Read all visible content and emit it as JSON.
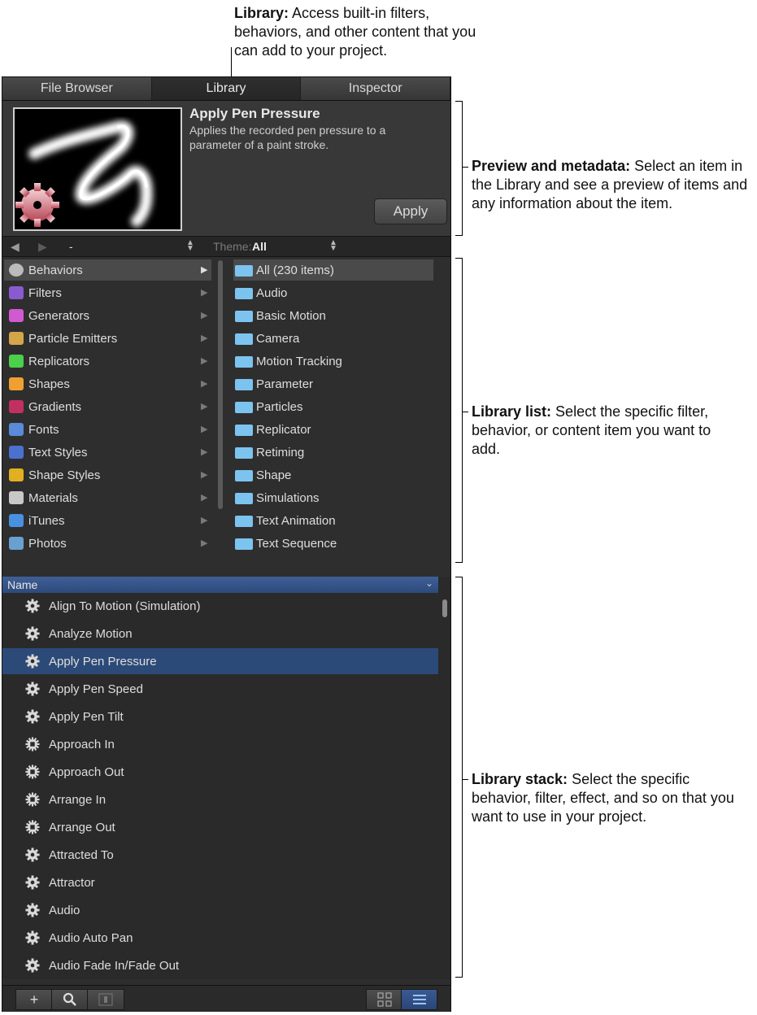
{
  "callouts": {
    "library": {
      "bold": "Library:",
      "text": "Access built-in filters, behaviors, and other content that you can add to your project."
    },
    "preview": {
      "bold": "Preview and metadata:",
      "text": "Select an item in the Library and see a preview of items and any information about the item."
    },
    "list": {
      "bold": "Library list:",
      "text": "Select the specific filter, behavior, or content item you want to add."
    },
    "stack": {
      "bold": "Library stack:",
      "text": "Select the specific behavior, filter, effect, and so on that you want to use in your project."
    }
  },
  "tabs": [
    {
      "label": "File Browser",
      "active": false
    },
    {
      "label": "Library",
      "active": true
    },
    {
      "label": "Inspector",
      "active": false
    }
  ],
  "preview": {
    "title": "Apply Pen Pressure",
    "description": "Applies the recorded pen pressure to a parameter of a paint stroke.",
    "apply_label": "Apply"
  },
  "nav": {
    "path_value": "-",
    "theme_label": "Theme:",
    "theme_value": "All"
  },
  "categories": [
    {
      "label": "Behaviors",
      "icon": "gear-icon",
      "color": "#bbbbbb",
      "selected": true
    },
    {
      "label": "Filters",
      "icon": "filters-icon",
      "color": "#8a5ad0",
      "selected": false
    },
    {
      "label": "Generators",
      "icon": "generators-icon",
      "color": "#d05ad0",
      "selected": false
    },
    {
      "label": "Particle Emitters",
      "icon": "particle-icon",
      "color": "#d4a64a",
      "selected": false
    },
    {
      "label": "Replicators",
      "icon": "replicator-icon",
      "color": "#4ad04a",
      "selected": false
    },
    {
      "label": "Shapes",
      "icon": "shapes-icon",
      "color": "#f0a030",
      "selected": false
    },
    {
      "label": "Gradients",
      "icon": "gradient-icon",
      "color": "#c03060",
      "selected": false
    },
    {
      "label": "Fonts",
      "icon": "font-icon",
      "color": "#5a8ad8",
      "selected": false
    },
    {
      "label": "Text Styles",
      "icon": "text-style-icon",
      "color": "#4a70d0",
      "selected": false
    },
    {
      "label": "Shape Styles",
      "icon": "shape-style-icon",
      "color": "#e0b020",
      "selected": false
    },
    {
      "label": "Materials",
      "icon": "materials-icon",
      "color": "#c8c8c8",
      "selected": false
    },
    {
      "label": "iTunes",
      "icon": "itunes-icon",
      "color": "#4a90e0",
      "selected": false
    },
    {
      "label": "Photos",
      "icon": "photos-icon",
      "color": "#6aa0d0",
      "selected": false
    }
  ],
  "folders": [
    {
      "label": "All (230 items)",
      "selected": true
    },
    {
      "label": "Audio",
      "selected": false
    },
    {
      "label": "Basic Motion",
      "selected": false
    },
    {
      "label": "Camera",
      "selected": false
    },
    {
      "label": "Motion Tracking",
      "selected": false
    },
    {
      "label": "Parameter",
      "selected": false
    },
    {
      "label": "Particles",
      "selected": false
    },
    {
      "label": "Replicator",
      "selected": false
    },
    {
      "label": "Retiming",
      "selected": false
    },
    {
      "label": "Shape",
      "selected": false
    },
    {
      "label": "Simulations",
      "selected": false
    },
    {
      "label": "Text Animation",
      "selected": false
    },
    {
      "label": "Text Sequence",
      "selected": false
    }
  ],
  "stack": {
    "column_header": "Name",
    "items": [
      {
        "label": "Align To Motion (Simulation)",
        "icon": "gear-icon",
        "selected": false
      },
      {
        "label": "Analyze Motion",
        "icon": "gear-icon",
        "selected": false
      },
      {
        "label": "Apply Pen Pressure",
        "icon": "gear-icon",
        "selected": true
      },
      {
        "label": "Apply Pen Speed",
        "icon": "gear-icon",
        "selected": false
      },
      {
        "label": "Apply Pen Tilt",
        "icon": "gear-icon",
        "selected": false
      },
      {
        "label": "Approach In",
        "icon": "text-gear-icon",
        "selected": false
      },
      {
        "label": "Approach Out",
        "icon": "text-gear-icon",
        "selected": false
      },
      {
        "label": "Arrange In",
        "icon": "text-gear-icon",
        "selected": false
      },
      {
        "label": "Arrange Out",
        "icon": "text-gear-icon",
        "selected": false
      },
      {
        "label": "Attracted To",
        "icon": "gear-icon",
        "selected": false
      },
      {
        "label": "Attractor",
        "icon": "gear-icon",
        "selected": false
      },
      {
        "label": "Audio",
        "icon": "gear-icon",
        "selected": false
      },
      {
        "label": "Audio Auto Pan",
        "icon": "gear-icon",
        "selected": false
      },
      {
        "label": "Audio Fade In/Fade Out",
        "icon": "gear-icon",
        "selected": false
      }
    ]
  },
  "bottom": {
    "add_label": "+",
    "search_label": "⚲"
  }
}
